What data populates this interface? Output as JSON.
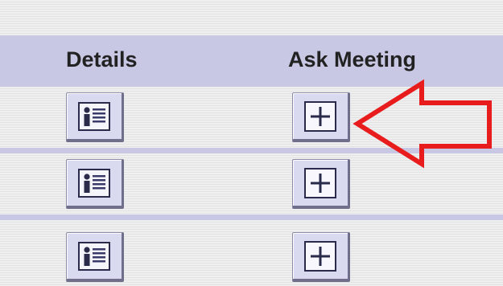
{
  "table": {
    "columns": [
      {
        "label": "Details"
      },
      {
        "label": "Ask Meeting"
      }
    ],
    "rows": [
      {
        "details_icon": "details-card-icon",
        "ask_icon": "plus-icon"
      },
      {
        "details_icon": "details-card-icon",
        "ask_icon": "plus-icon"
      },
      {
        "details_icon": "details-card-icon",
        "ask_icon": "plus-icon"
      }
    ]
  },
  "annotation": {
    "type": "arrow",
    "direction": "left",
    "color": "#e81c1c",
    "points_to": "ask-meeting-button row 1"
  },
  "colors": {
    "header_background": "#c8c8e4",
    "button_face": "#d9d9ef",
    "row_stripe": "#ececec",
    "arrow": "#e81c1c"
  }
}
